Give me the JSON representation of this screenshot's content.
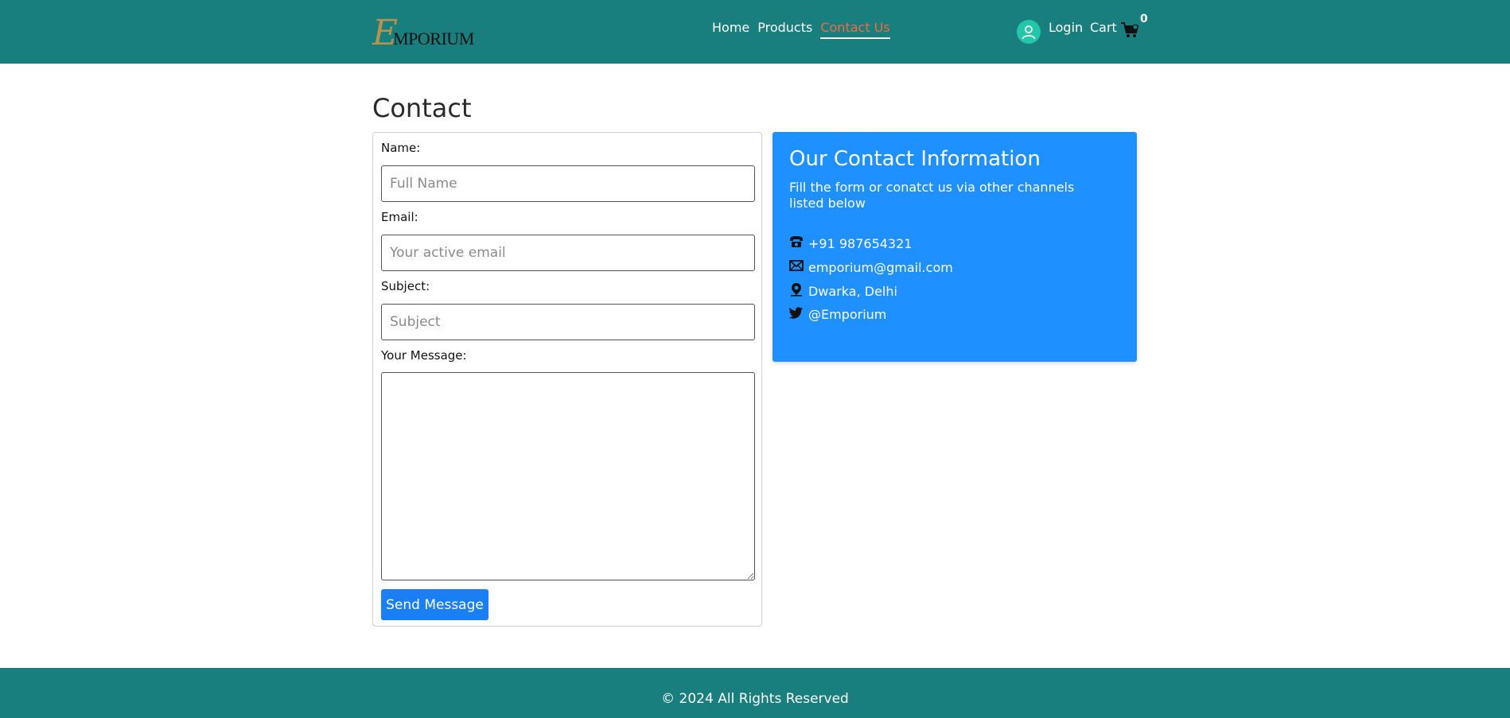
{
  "brand": {
    "logo_letter": "E",
    "logo_text": "MPORIUM",
    "logo_alt": "Emporium"
  },
  "nav": {
    "items": [
      {
        "label": "Home"
      },
      {
        "label": "Products"
      },
      {
        "label": "Contact Us",
        "active": true
      }
    ]
  },
  "account": {
    "login_label": "Login",
    "cart_label": "Cart",
    "cart_count": "0"
  },
  "page": {
    "title": "Contact"
  },
  "form": {
    "name_label": "Name:",
    "name_placeholder": "Full Name",
    "name_value": "",
    "email_label": "Email:",
    "email_placeholder": "Your active email",
    "email_value": "",
    "subject_label": "Subject:",
    "subject_placeholder": "Subject",
    "subject_value": "",
    "message_label": "Your Message:",
    "message_value": "",
    "submit_label": "Send Message"
  },
  "contact_info": {
    "title": "Our Contact Information",
    "description": "Fill the form or conatct us via other channels listed below",
    "phone": "+91 987654321",
    "email": "emporium@gmail.com",
    "address": "Dwarka, Delhi",
    "twitter": "@Emporium"
  },
  "footer": {
    "copyright": "© 2024 All Rights Reserved"
  },
  "colors": {
    "header_bg": "#187f7e",
    "nav_active": "#f36a3c",
    "info_card_bg": "#1e90ff",
    "button_bg": "#1a7ff2",
    "avatar_bg": "#22c7a9"
  },
  "icons": [
    "user-icon",
    "cart-icon",
    "phone-icon",
    "mail-icon",
    "location-icon",
    "twitter-icon"
  ]
}
